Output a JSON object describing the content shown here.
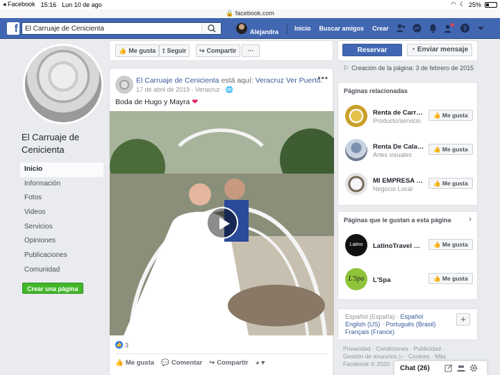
{
  "status_bar": {
    "app": "Facebook",
    "time": "15:16",
    "date": "Lun 10 de ago",
    "url": "facebook.com",
    "battery": "25%",
    "battery_level": 0.25
  },
  "topbar": {
    "search_value": "El Carruaje de Cenicienta",
    "user_name": "Alejandra",
    "nav": [
      "Inicio",
      "Buscar amigos",
      "Crear"
    ]
  },
  "page": {
    "name": "El Carruaje de Cenicienta",
    "left_nav": [
      "Inicio",
      "Información",
      "Fotos",
      "Videos",
      "Servicios",
      "Opiniones",
      "Publicaciones",
      "Comunidad"
    ],
    "create_page": "Crear una página"
  },
  "action_bar": {
    "like": "Me gusta",
    "follow": "Seguir",
    "share": "Compartir",
    "more": "···"
  },
  "post": {
    "author": "El Carruaje de Cenicienta",
    "verb": " está aquí: ",
    "location": "Veracruz Ver Puerto.",
    "date": "17 de abril de 2019",
    "place": "Veracruz",
    "text": "Boda de Hugo y Mayra",
    "reaction_count": "3",
    "actions": {
      "like": "Me gusta",
      "comment": "Comentar",
      "share": "Compartir"
    }
  },
  "right_column": {
    "reservar": "Reservar",
    "send_message": "Enviar mensaje",
    "creation": "Creación de la página: 3 de febrero de 2015",
    "related_title": "Páginas relacionadas",
    "related": [
      {
        "name": "Renta de Carruajes",
        "category": "Producto/servicio",
        "like": "Me gusta"
      },
      {
        "name": "Renta De Calandrias",
        "category": "Artes visuales",
        "like": "Me gusta"
      },
      {
        "name": "MI EMPRESA R...",
        "category": "Negocio Local",
        "like": "Me gusta"
      }
    ],
    "liked_title": "Páginas que le gustan a esta página",
    "liked": [
      {
        "name": "LatinoTravel México",
        "like": "Me gusta"
      },
      {
        "name": "L'Spa",
        "like": "Me gusta"
      }
    ],
    "languages": {
      "current": "Español (España)",
      "links": [
        "Español",
        "English (US)",
        "Português (Brasil)",
        "Français (France)"
      ]
    },
    "footer": [
      "Privacidad",
      "Condiciones",
      "Publicidad",
      "Gestión de anuncios",
      "Cookies",
      "Más",
      "Facebook © 2020"
    ]
  },
  "chat": {
    "label": "Chat (26)"
  },
  "colors": {
    "brand_blue": "#4267b2",
    "green": "#42b72a",
    "link": "#385898"
  }
}
